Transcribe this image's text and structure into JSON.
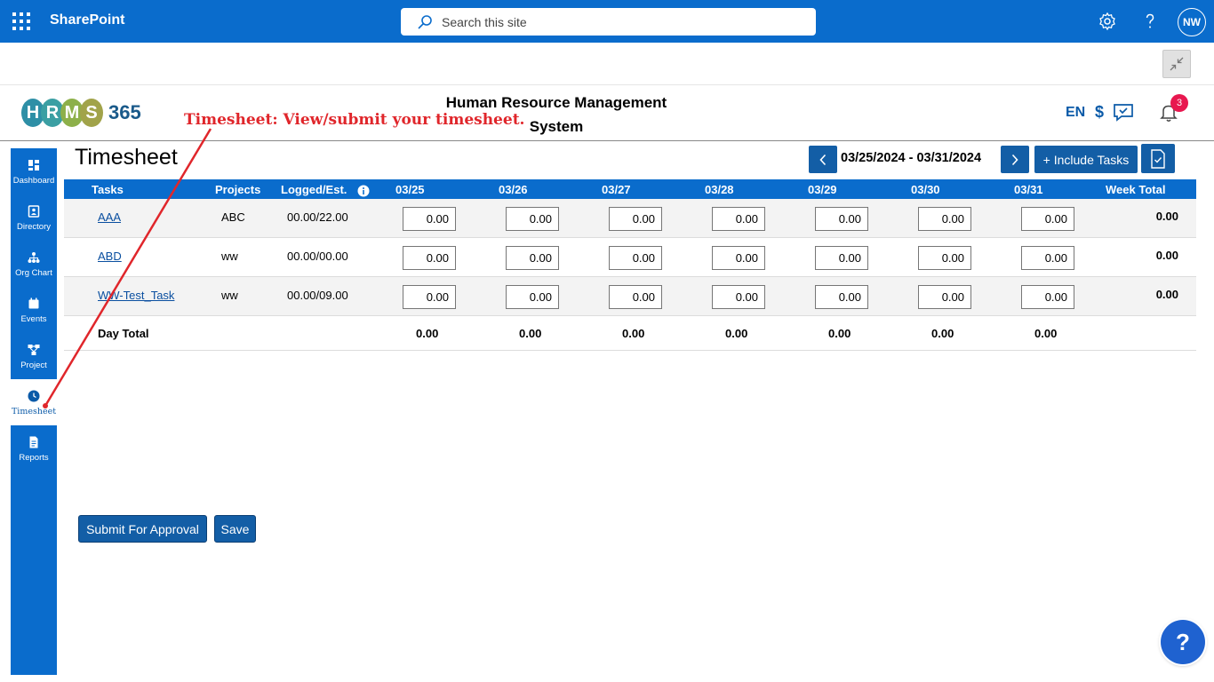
{
  "suitebar": {
    "brand": "SharePoint",
    "search_placeholder": "Search this site",
    "avatar_initials": "NW"
  },
  "header": {
    "logo_letters": [
      "H",
      "R",
      "M",
      "S"
    ],
    "logo_number": "365",
    "title_line1": "Human Resource Management",
    "title_line2": "System",
    "annotation": "Timesheet: View/submit your timesheet.",
    "language": "EN",
    "currency": "$",
    "notification_count": "3"
  },
  "nav": {
    "items": [
      {
        "label": "Dashboard",
        "icon": "dashboard-icon"
      },
      {
        "label": "Directory",
        "icon": "directory-icon"
      },
      {
        "label": "Org Chart",
        "icon": "org-chart-icon"
      },
      {
        "label": "Events",
        "icon": "calendar-icon"
      },
      {
        "label": "Project",
        "icon": "project-icon"
      },
      {
        "label": "Timesheet",
        "icon": "clock-icon"
      },
      {
        "label": "Reports",
        "icon": "report-icon"
      }
    ],
    "active": "Timesheet"
  },
  "main": {
    "title": "Timesheet",
    "date_range": "03/25/2024 - 03/31/2024",
    "include_tasks_label": "+ Include Tasks"
  },
  "table": {
    "headers": {
      "tasks": "Tasks",
      "projects": "Projects",
      "logged": "Logged/Est.",
      "days": [
        "03/25",
        "03/26",
        "03/27",
        "03/28",
        "03/29",
        "03/30",
        "03/31"
      ],
      "week_total": "Week Total"
    },
    "rows": [
      {
        "task": "AAA",
        "project": "ABC",
        "logged": "00.00/22.00",
        "hours": [
          "0.00",
          "0.00",
          "0.00",
          "0.00",
          "0.00",
          "0.00",
          "0.00"
        ],
        "week_total": "0.00"
      },
      {
        "task": "ABD",
        "project": "ww",
        "logged": "00.00/00.00",
        "hours": [
          "0.00",
          "0.00",
          "0.00",
          "0.00",
          "0.00",
          "0.00",
          "0.00"
        ],
        "week_total": "0.00"
      },
      {
        "task": "WW-Test_Task",
        "project": "ww",
        "logged": "00.00/09.00",
        "hours": [
          "0.00",
          "0.00",
          "0.00",
          "0.00",
          "0.00",
          "0.00",
          "0.00"
        ],
        "week_total": "0.00"
      }
    ],
    "day_total_label": "Day Total",
    "day_totals": [
      "0.00",
      "0.00",
      "0.00",
      "0.00",
      "0.00",
      "0.00",
      "0.00"
    ]
  },
  "actions": {
    "submit_label": "Submit For Approval",
    "save_label": "Save",
    "help_label": "?"
  },
  "colors": {
    "suite_blue": "#0a6ccc",
    "button_blue": "#135ea6",
    "annotation_red": "#e0262b",
    "badge_pink": "#e8174f",
    "logo_teal": "#2e8fa6",
    "logo_green": "#8db04a",
    "logo_olive": "#a1a34a"
  }
}
